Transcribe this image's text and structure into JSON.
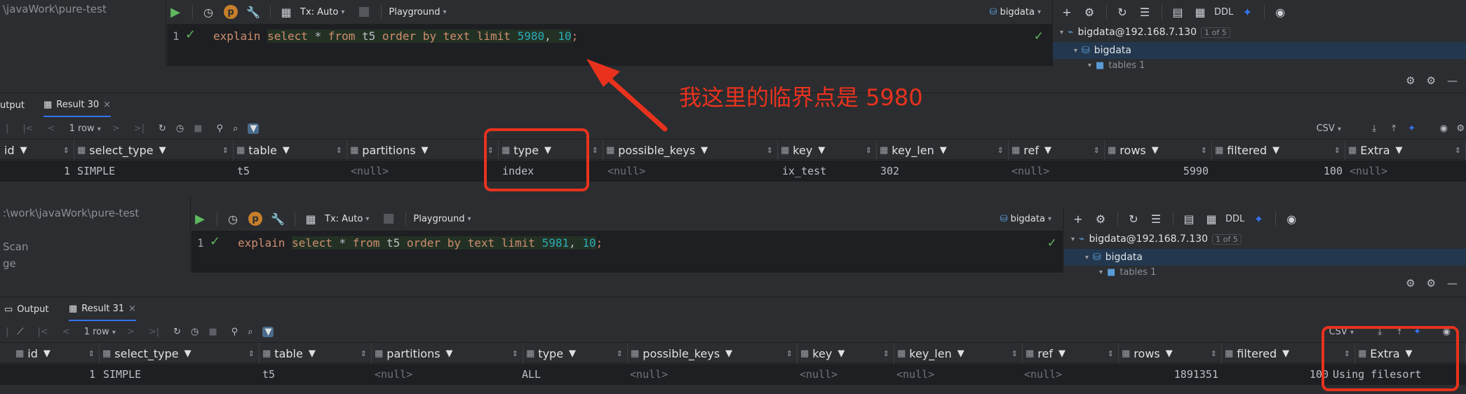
{
  "panel1": {
    "project_path": "\\javaWork\\pure-test",
    "toolbar": {
      "tx": "Tx: Auto",
      "playground": "Playground",
      "schema": "bigdata",
      "ddl": "DDL"
    },
    "editor": {
      "line_no": "1",
      "tokens": [
        "explain",
        "select",
        "*",
        "from",
        "t5",
        "order",
        "by",
        "text",
        "limit",
        "5980",
        ",",
        "10",
        ";"
      ]
    },
    "tree": {
      "connection": "bigdata@192.168.7.130",
      "badge": "1 of 5",
      "db": "bigdata",
      "tables": "tables 1"
    },
    "tabs": {
      "output": "utput",
      "result": "Result 30"
    },
    "results_toolbar": {
      "rows": "1 row",
      "export": "CSV"
    },
    "columns": [
      "id",
      "select_type",
      "table",
      "partitions",
      "type",
      "possible_keys",
      "key",
      "key_len",
      "ref",
      "rows",
      "filtered",
      "Extra"
    ],
    "row": {
      "id": "1",
      "select_type": "SIMPLE",
      "table": "t5",
      "partitions": "<null>",
      "type": "index",
      "possible_keys": "<null>",
      "key": "ix_test",
      "key_len": "302",
      "ref": "<null>",
      "rows": "5990",
      "filtered": "100",
      "Extra": "<null>"
    }
  },
  "panel2": {
    "project_path": ":\\work\\javaWork\\pure-test",
    "side_items": [
      "Scan",
      "ge"
    ],
    "toolbar": {
      "tx": "Tx: Auto",
      "playground": "Playground",
      "schema": "bigdata",
      "ddl": "DDL"
    },
    "editor": {
      "line_no": "1",
      "tokens": [
        "explain",
        "select",
        "*",
        "from",
        "t5",
        "order",
        "by",
        "text",
        "limit",
        "5981",
        ",",
        "10",
        ";"
      ]
    },
    "tree": {
      "connection": "bigdata@192.168.7.130",
      "badge": "1 of 5",
      "db": "bigdata",
      "tables": "tables 1"
    },
    "tabs": {
      "output": "Output",
      "result": "Result 31"
    },
    "results_toolbar": {
      "rows": "1 row",
      "export": "CSV"
    },
    "columns": [
      "id",
      "select_type",
      "table",
      "partitions",
      "type",
      "possible_keys",
      "key",
      "key_len",
      "ref",
      "rows",
      "filtered",
      "Extra"
    ],
    "row": {
      "id": "1",
      "select_type": "SIMPLE",
      "table": "t5",
      "partitions": "<null>",
      "type": "ALL",
      "possible_keys": "<null>",
      "key": "<null>",
      "key_len": "<null>",
      "ref": "<null>",
      "rows": "1891351",
      "filtered": "100",
      "Extra": "Using filesort"
    }
  },
  "annotation": {
    "text": "我这里的临界点是 5980",
    "color": "#e8321e"
  },
  "colors": {
    "keyword": "#cf8e6d",
    "number": "#2aacb8",
    "ok": "#5fb85f",
    "accent": "#3574f0"
  }
}
